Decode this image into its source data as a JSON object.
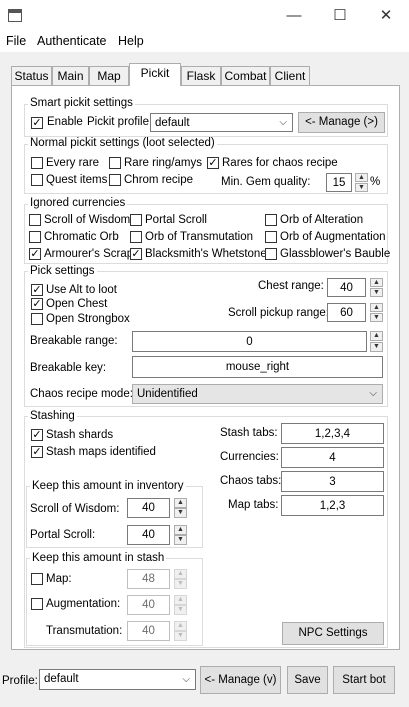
{
  "window": {
    "minimize_glyph": "—",
    "maximize_glyph": "☐",
    "close_glyph": "✕"
  },
  "menu": {
    "file": "File",
    "authenticate": "Authenticate",
    "help": "Help"
  },
  "tabs": [
    "Status",
    "Main",
    "Map",
    "Pickit",
    "Flask",
    "Combat",
    "Client"
  ],
  "smart": {
    "title": "Smart pickit settings",
    "enable": "Enable",
    "enable_checked": true,
    "profile_label": "Pickit profile:",
    "profile_value": "default",
    "manage_label": "<- Manage (>)"
  },
  "normal": {
    "title": "Normal pickit settings (loot selected)",
    "items": [
      {
        "label": "Every rare",
        "checked": false
      },
      {
        "label": "Rare ring/amys",
        "checked": false
      },
      {
        "label": "Rares for chaos recipe",
        "checked": true
      },
      {
        "label": "Quest items",
        "checked": false
      },
      {
        "label": "Chrom recipe",
        "checked": false
      }
    ],
    "gem_label": "Min. Gem quality:",
    "gem_value": "15",
    "gem_unit": "%"
  },
  "ignored": {
    "title": "Ignored currencies",
    "items": [
      {
        "label": "Scroll of Wisdom",
        "checked": false
      },
      {
        "label": "Portal Scroll",
        "checked": false
      },
      {
        "label": "Orb of Alteration",
        "checked": false
      },
      {
        "label": "Chromatic Orb",
        "checked": false
      },
      {
        "label": "Orb of Transmutation",
        "checked": false
      },
      {
        "label": "Orb of Augmentation",
        "checked": false
      },
      {
        "label": "Armourer's Scrap",
        "checked": true
      },
      {
        "label": "Blacksmith's Whetstone",
        "checked": true
      },
      {
        "label": "Glassblower's Bauble",
        "checked": false
      }
    ]
  },
  "pick": {
    "title": "Pick settings",
    "use_alt": {
      "label": "Use Alt to loot",
      "checked": true
    },
    "open_chest": {
      "label": "Open Chest",
      "checked": true
    },
    "open_strongbox": {
      "label": "Open Strongbox",
      "checked": false
    },
    "chest_label": "Chest range:",
    "chest_value": "40",
    "scroll_label": "Scroll pickup range:",
    "scroll_value": "60",
    "breakable_range_label": "Breakable range:",
    "breakable_range_value": "0",
    "breakable_key_label": "Breakable key:",
    "breakable_key_value": "mouse_right",
    "chaos_mode_label": "Chaos recipe mode:",
    "chaos_mode_value": "Unidentified"
  },
  "stashing": {
    "title": "Stashing",
    "shards": {
      "label": "Stash shards",
      "checked": true
    },
    "maps": {
      "label": "Stash maps identified",
      "checked": true
    },
    "stash_tabs_label": "Stash tabs:",
    "stash_tabs_value": "1,2,3,4",
    "currencies_label": "Currencies:",
    "currencies_value": "4",
    "chaos_tabs_label": "Chaos tabs:",
    "chaos_tabs_value": "3",
    "map_tabs_label": "Map tabs:",
    "map_tabs_value": "1,2,3",
    "npc_button": "NPC Settings"
  },
  "inventory": {
    "title": "Keep this amount in inventory",
    "wisdom_label": "Scroll of Wisdom:",
    "wisdom_value": "40",
    "portal_label": "Portal Scroll:",
    "portal_value": "40"
  },
  "stash_keep": {
    "title": "Keep this amount in stash",
    "map": {
      "label": "Map:",
      "checked": false,
      "value": "48"
    },
    "aug": {
      "label": "Augmentation:",
      "checked": false,
      "value": "40"
    },
    "trans": {
      "label": "Transmutation:",
      "value": "40"
    }
  },
  "footer": {
    "profile_label": "Profile:",
    "profile_value": "default",
    "manage_label": "<- Manage (v)",
    "save_label": "Save",
    "start_label": "Start bot"
  },
  "icons": {
    "check": "✓",
    "caret": "⌵",
    "spin_up": "▲",
    "spin_down": "▼"
  }
}
